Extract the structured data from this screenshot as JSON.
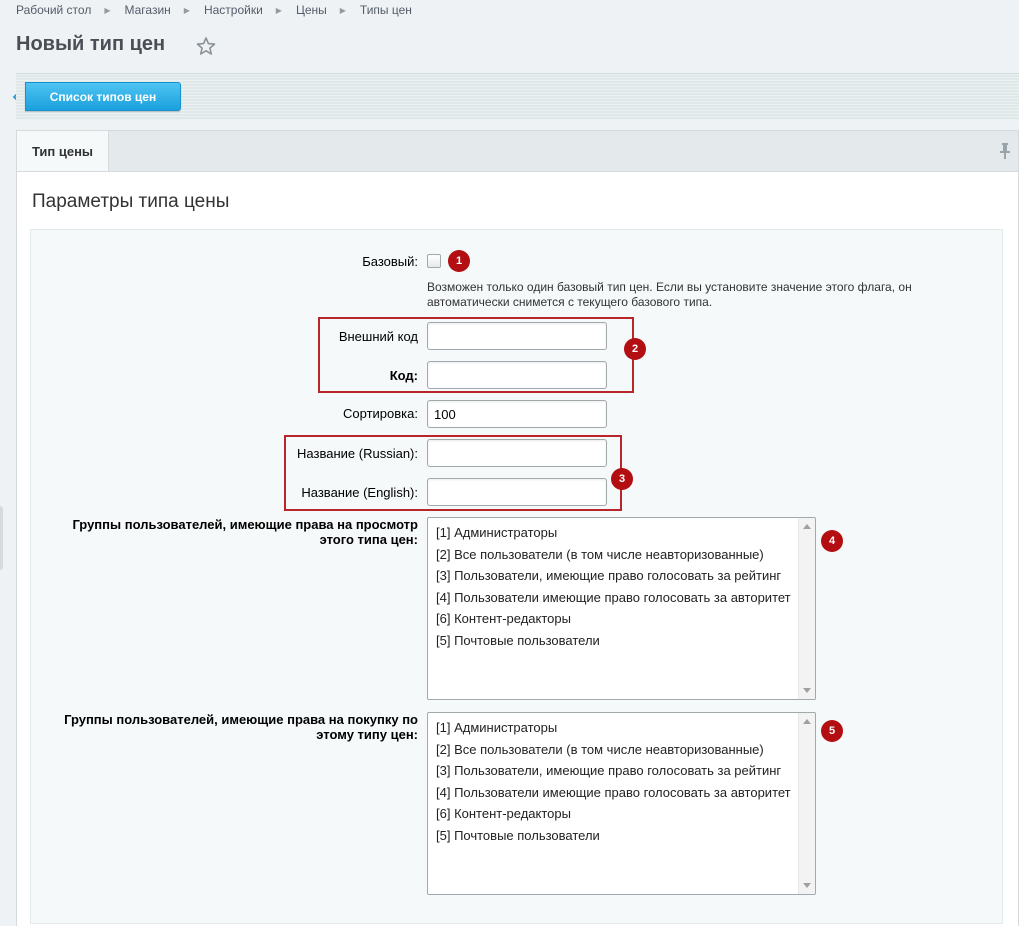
{
  "breadcrumb": [
    "Рабочий стол",
    "Магазин",
    "Настройки",
    "Цены",
    "Типы цен"
  ],
  "page": {
    "title": "Новый тип цен"
  },
  "toolbar": {
    "list_button": "Список типов цен"
  },
  "tabs": [
    {
      "label": "Тип цены",
      "active": true
    }
  ],
  "section": {
    "title": "Параметры типа цены"
  },
  "form": {
    "base_label": "Базовый:",
    "base_checked": false,
    "base_hint": "Возможен только один базовый тип цен. Если вы установите значение этого флага, он автоматически снимется с текущего базового типа.",
    "external_code_label": "Внешний код",
    "external_code_value": "",
    "code_label": "Код:",
    "code_value": "",
    "sort_label": "Сортировка:",
    "sort_value": "100",
    "name_ru_label": "Название (Russian):",
    "name_ru_value": "",
    "name_en_label": "Название (English):",
    "name_en_value": "",
    "view_groups_label": "Группы пользователей, имеющие права на просмотр этого типа цен:",
    "buy_groups_label": "Группы пользователей, имеющие права на покупку по этому типу цен:",
    "groups": [
      "[1] Администраторы",
      "[2] Все пользователи (в том числе неавторизованные)",
      "[3] Пользователи, имеющие право голосовать за рейтинг",
      "[4] Пользователи имеющие право голосовать за авторитет",
      "[6] Контент-редакторы",
      "[5] Почтовые пользователи"
    ]
  },
  "markers": [
    "1",
    "2",
    "3",
    "4",
    "5"
  ],
  "colors": {
    "accent": "#1aa0dd",
    "marker": "#b30e12",
    "highlight_box": "#b8262a"
  }
}
